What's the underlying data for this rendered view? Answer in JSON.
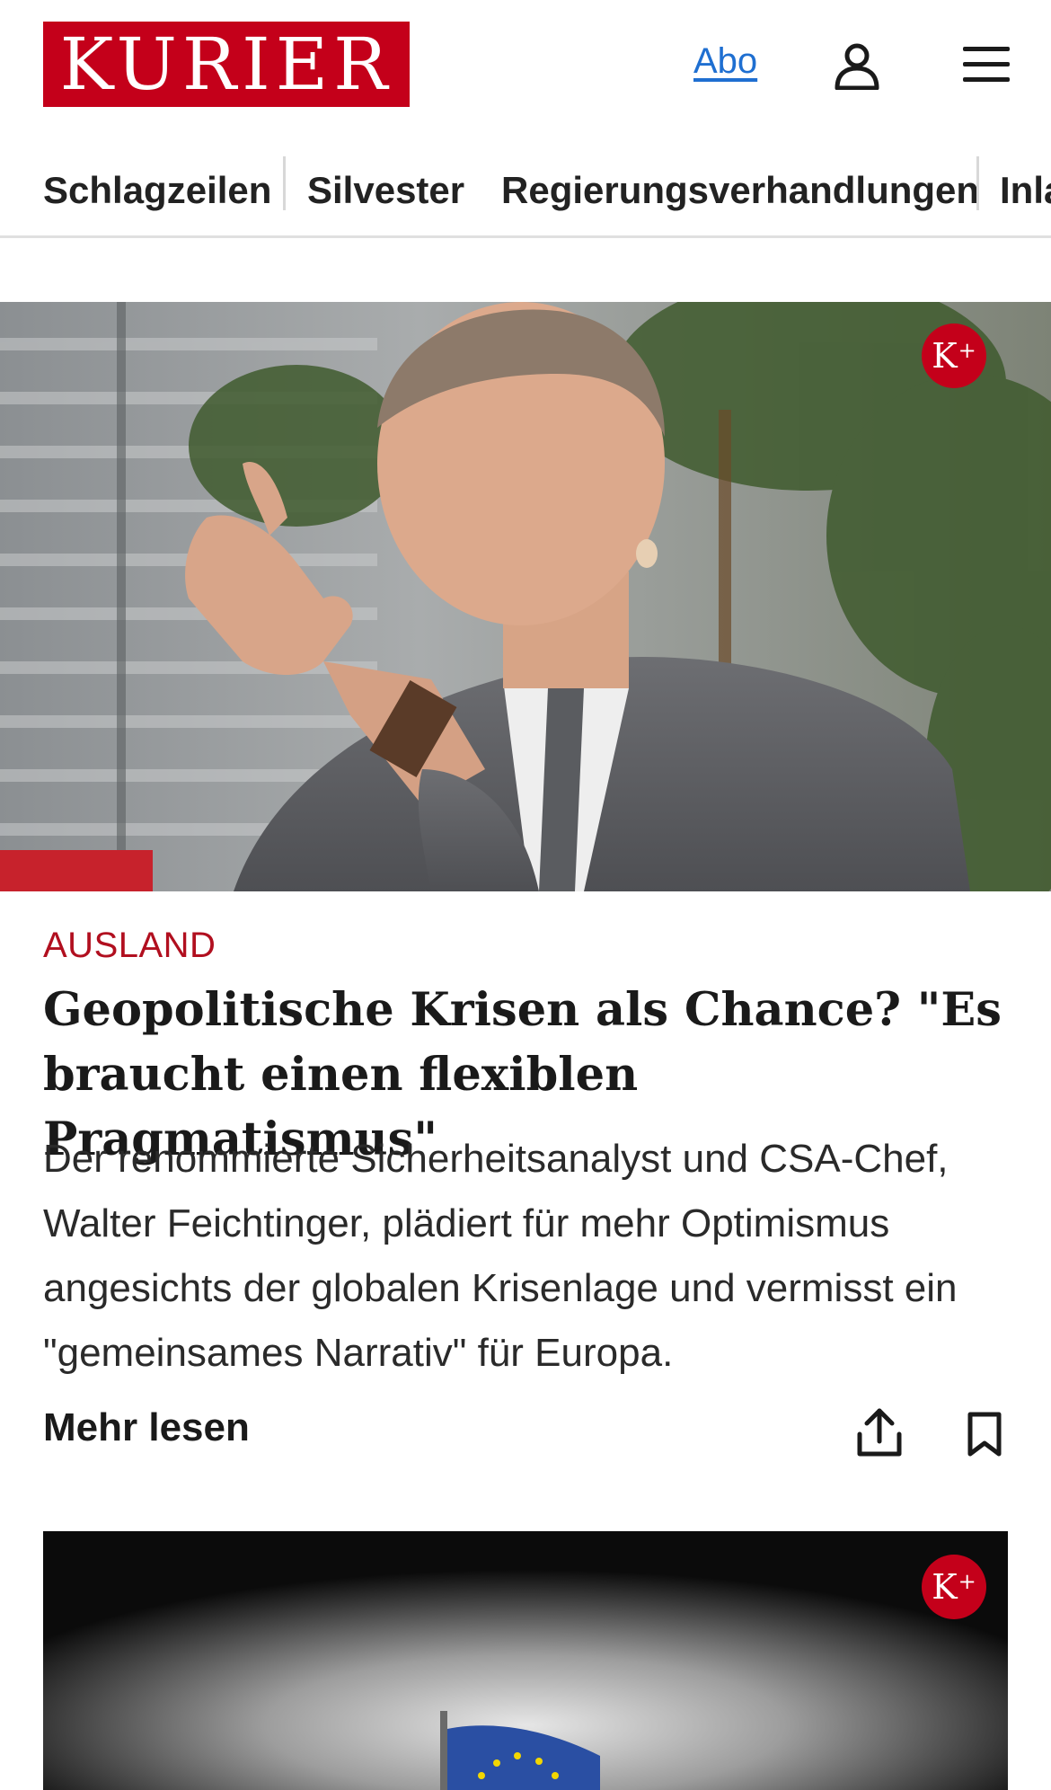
{
  "header": {
    "logo_text": "KURIER",
    "abo_label": "Abo"
  },
  "nav": {
    "items": [
      "Schlagzeilen",
      "Silvester",
      "Regierungsverhandlungen",
      "Inla"
    ]
  },
  "article": {
    "badge": "K+",
    "category": "AUSLAND",
    "headline": "Geopolitische Krisen als Chance? \"Es braucht einen flexiblen Pragmatismus\"",
    "teaser": "Der renommierte Sicherheitsanalyst und CSA-Chef, Walter Feichtinger, plädiert für mehr Optimismus angesichts der globalen Krisenlage und vermisst ein \"gemeinsames Narrativ\" für Europa.",
    "more_label": "Mehr lesen"
  },
  "second_article": {
    "badge": "K+"
  },
  "colors": {
    "brand_red": "#c4001a",
    "link_blue": "#1f6fd1",
    "category_red": "#b10f1f"
  },
  "icons": [
    "user-icon",
    "menu-icon",
    "share-icon",
    "bookmark-icon",
    "kplus-badge-icon"
  ]
}
